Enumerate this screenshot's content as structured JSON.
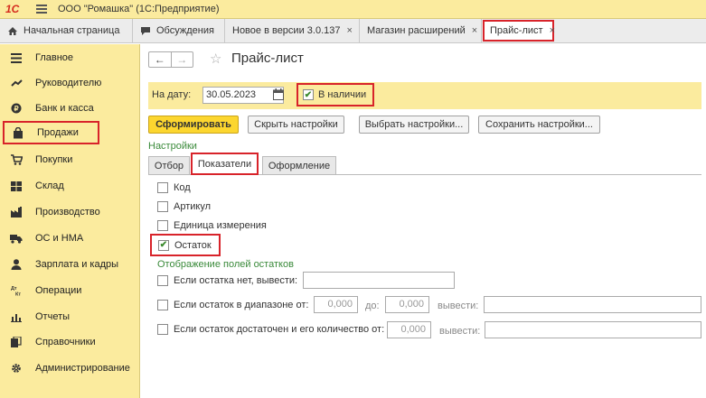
{
  "app": {
    "title": "ООО \"Ромашка\"  (1С:Предприятие)",
    "logo_text": "1С"
  },
  "tabs": [
    {
      "label": "Начальная страница",
      "icon": "home-icon"
    },
    {
      "label": "Обсуждения",
      "icon": "chat-icon"
    },
    {
      "label": "Новое в версии 3.0.137",
      "closable": true
    },
    {
      "label": "Магазин расширений",
      "closable": true
    },
    {
      "label": "Прайс-лист",
      "closable": true,
      "active": true
    }
  ],
  "close_glyph": "×",
  "sidebar": {
    "items": [
      {
        "label": "Главное",
        "icon": "menu-lines-icon"
      },
      {
        "label": "Руководителю",
        "icon": "trend-icon"
      },
      {
        "label": "Банк и касса",
        "icon": "coin-icon"
      },
      {
        "label": "Продажи",
        "icon": "bag-icon",
        "selected": true
      },
      {
        "label": "Покупки",
        "icon": "cart-icon"
      },
      {
        "label": "Склад",
        "icon": "warehouse-icon"
      },
      {
        "label": "Производство",
        "icon": "factory-icon"
      },
      {
        "label": "ОС и НМА",
        "icon": "truck-icon"
      },
      {
        "label": "Зарплата и кадры",
        "icon": "person-icon"
      },
      {
        "label": "Операции",
        "icon": "dt-kt-icon"
      },
      {
        "label": "Отчеты",
        "icon": "bar-chart-icon"
      },
      {
        "label": "Справочники",
        "icon": "books-icon"
      },
      {
        "label": "Администрирование",
        "icon": "gear-icon"
      }
    ]
  },
  "page": {
    "title": "Прайс-лист",
    "nav_back": "←",
    "nav_forward": "→",
    "star": "☆"
  },
  "filter": {
    "date_label": "На дату:",
    "date_value": "30.05.2023",
    "in_stock_label": "В наличии",
    "in_stock_checked": true
  },
  "buttons": {
    "generate": "Сформировать",
    "hide_settings": "Скрыть настройки",
    "choose_settings": "Выбрать настройки...",
    "save_settings": "Сохранить настройки..."
  },
  "settings": {
    "label": "Настройки",
    "tabs": [
      "Отбор",
      "Показатели",
      "Оформление"
    ],
    "active_tab": "Показатели"
  },
  "indicators": [
    {
      "label": "Код",
      "checked": false
    },
    {
      "label": "Артикул",
      "checked": false
    },
    {
      "label": "Единица измерения",
      "checked": false
    },
    {
      "label": "Остаток",
      "checked": true
    }
  ],
  "stock_display": {
    "heading": "Отображение полей остатков",
    "row1": {
      "label": "Если остатка нет, вывести:",
      "checked": false
    },
    "row2": {
      "label": "Если остаток в диапазоне от:",
      "from": "0,000",
      "to_label": "до:",
      "to": "0,000",
      "output_label": "вывести:",
      "checked": false
    },
    "row3": {
      "label": "Если остаток достаточен и его количество от:",
      "from": "0,000",
      "output_label": "вывести:",
      "checked": false
    }
  },
  "colors": {
    "panel_yellow": "#fbeb9e",
    "highlight_red": "#d8232a",
    "primary_button": "#fcd62f",
    "section_green": "#3a8a3a"
  }
}
